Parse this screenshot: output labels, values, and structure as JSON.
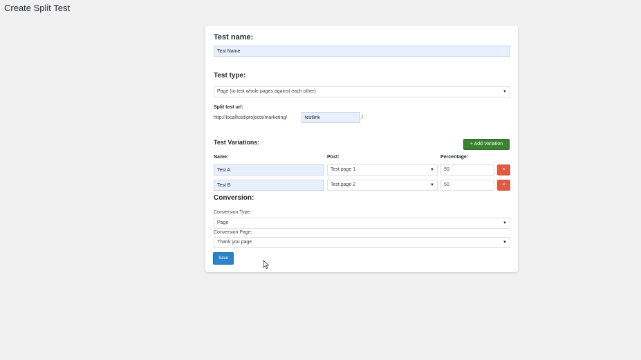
{
  "page": {
    "title": "Create Split Test"
  },
  "test_name": {
    "label": "Test name:",
    "value": "Test Name"
  },
  "test_type": {
    "label": "Test type:",
    "selected": "Page (to test whole pages against each other)"
  },
  "split_url": {
    "label": "Split test url:",
    "prefix": "http://localhost/projects/marketing/",
    "slug": "testlink",
    "suffix": "/"
  },
  "variations": {
    "label": "Test Variations:",
    "add_label": "+ Add Variation",
    "col_name": "Name:",
    "col_post": "Post:",
    "col_percentage": "Percentage:",
    "rows": [
      {
        "name": "Test A",
        "post": "Test page 1",
        "percentage": "50",
        "delete": "×"
      },
      {
        "name": "Test B",
        "post": "Test page 2",
        "percentage": "50",
        "delete": "×"
      }
    ]
  },
  "conversion": {
    "label": "Conversion:",
    "type_label": "Conversion Type:",
    "type_value": "Page",
    "page_label": "Conversion Page:",
    "page_value": "Thank you page"
  },
  "save_label": "Save",
  "icons": {
    "dropdown": "chevron-down-icon",
    "pointer": "mouse-pointer-icon"
  }
}
